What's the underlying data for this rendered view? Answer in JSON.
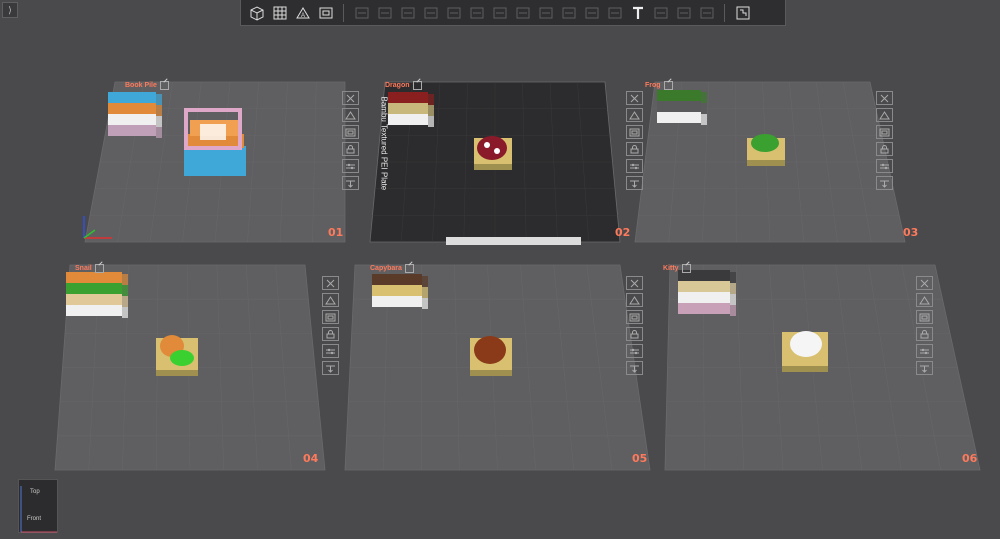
{
  "app": {
    "collapse_icon": "collapse-arrows-icon"
  },
  "toolbar": {
    "items": [
      {
        "icon": "add-cube-icon",
        "dim": false
      },
      {
        "icon": "grid-arrange-icon",
        "dim": false
      },
      {
        "icon": "auto-orient-icon",
        "dim": false
      },
      {
        "icon": "plate-settings-icon",
        "dim": false
      },
      {
        "icon": "layers-icon",
        "dim": true
      },
      {
        "icon": "split-icon",
        "dim": true
      },
      {
        "icon": "stack-icon",
        "dim": true
      },
      {
        "icon": "move-icon",
        "dim": true
      },
      {
        "icon": "rotate-icon",
        "dim": true
      },
      {
        "icon": "scale-icon",
        "dim": true
      },
      {
        "icon": "lay-flat-icon",
        "dim": true
      },
      {
        "icon": "cut-icon",
        "dim": true
      },
      {
        "icon": "support-paint-icon",
        "dim": true
      },
      {
        "icon": "seam-paint-icon",
        "dim": true
      },
      {
        "icon": "color-paint-icon",
        "dim": true
      },
      {
        "icon": "measure-icon",
        "dim": true
      },
      {
        "icon": "text-icon",
        "dim": false
      },
      {
        "icon": "svg-emboss-icon",
        "dim": true
      },
      {
        "icon": "boolean-icon",
        "dim": true
      },
      {
        "icon": "brim-ears-icon",
        "dim": true
      },
      {
        "icon": "assembly-icon",
        "dim": false
      }
    ]
  },
  "plates": [
    {
      "name": "Book Pile",
      "number": "01",
      "active": false
    },
    {
      "name": "Dragon",
      "number": "02",
      "active": true,
      "bed_label": "Bambu Textured PEI Plate"
    },
    {
      "name": "Frog",
      "number": "03",
      "active": false
    },
    {
      "name": "Snail",
      "number": "04",
      "active": false
    },
    {
      "name": "Capybara",
      "number": "05",
      "active": false
    },
    {
      "name": "Kitty",
      "number": "06",
      "active": false
    }
  ],
  "plate_buttons": [
    "delete-plate-icon",
    "orient-plate-icon",
    "arrange-plate-icon",
    "lock-plate-icon",
    "plate-settings-icon",
    "move-plate-icon"
  ],
  "colors": {
    "accent": "#ff7a5c",
    "bed": "#5f5f61",
    "active_bed": "#2c2c2e"
  },
  "view_cube": {
    "top": "Top",
    "front": "Front"
  }
}
